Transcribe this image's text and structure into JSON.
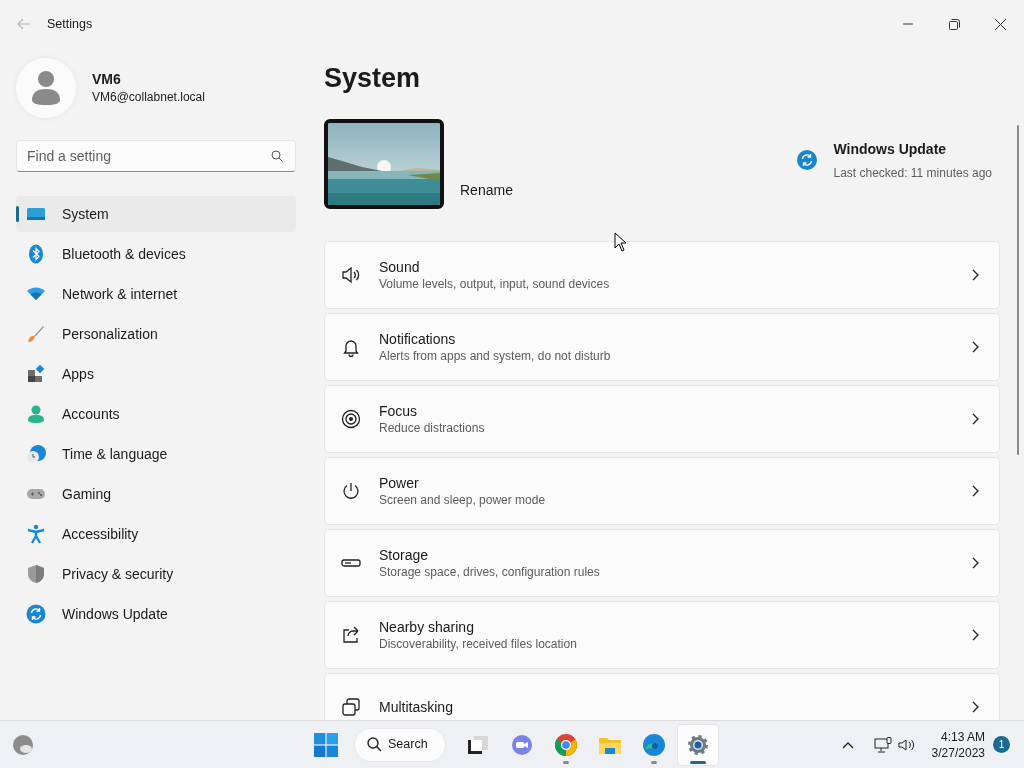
{
  "window": {
    "title": "Settings"
  },
  "user": {
    "name": "VM6",
    "email": "VM6@collabnet.local"
  },
  "search": {
    "placeholder": "Find a setting"
  },
  "sidebar": {
    "items": [
      {
        "label": "System",
        "selected": true
      },
      {
        "label": "Bluetooth & devices",
        "selected": false
      },
      {
        "label": "Network & internet",
        "selected": false
      },
      {
        "label": "Personalization",
        "selected": false
      },
      {
        "label": "Apps",
        "selected": false
      },
      {
        "label": "Accounts",
        "selected": false
      },
      {
        "label": "Time & language",
        "selected": false
      },
      {
        "label": "Gaming",
        "selected": false
      },
      {
        "label": "Accessibility",
        "selected": false
      },
      {
        "label": "Privacy & security",
        "selected": false
      },
      {
        "label": "Windows Update",
        "selected": false
      }
    ]
  },
  "page": {
    "title": "System",
    "rename": "Rename",
    "update": {
      "title": "Windows Update",
      "status": "Last checked: 11 minutes ago"
    },
    "cards": [
      {
        "title": "Sound",
        "description": "Volume levels, output, input, sound devices"
      },
      {
        "title": "Notifications",
        "description": "Alerts from apps and system, do not disturb"
      },
      {
        "title": "Focus",
        "description": "Reduce distractions"
      },
      {
        "title": "Power",
        "description": "Screen and sleep, power mode"
      },
      {
        "title": "Storage",
        "description": "Storage space, drives, configuration rules"
      },
      {
        "title": "Nearby sharing",
        "description": "Discoverability, received files location"
      },
      {
        "title": "Multitasking"
      }
    ]
  },
  "taskbar": {
    "search": "Search",
    "apps": [
      {
        "running": false,
        "selected": false
      },
      {
        "running": false,
        "selected": false
      },
      {
        "running": true,
        "selected": false
      },
      {
        "running": false,
        "selected": false
      },
      {
        "running": true,
        "selected": false
      },
      {
        "running": true,
        "selected": true
      }
    ],
    "time": "4:13 AM",
    "date": "3/27/2023",
    "notifications": "1"
  }
}
